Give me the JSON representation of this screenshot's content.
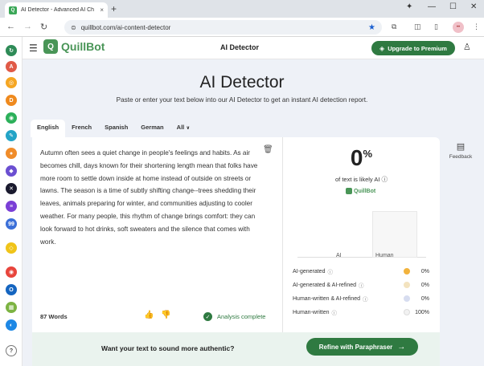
{
  "browser": {
    "tab_title": "AI Detector - Advanced AI Ch",
    "tab_close": "×",
    "new_tab": "+",
    "url": "quillbot.com/ai-content-detector",
    "profile_initials": "••",
    "minimize": "—",
    "maximize": "☐",
    "close": "✕"
  },
  "header": {
    "logo_text": "QuillBot",
    "logo_mark": "Q",
    "title": "AI Detector",
    "premium_label": "Upgrade to Premium"
  },
  "hero": {
    "title": "AI Detector",
    "subtitle": "Paste or enter your text below into our AI Detector to get an instant AI detection report."
  },
  "languages": {
    "tabs": [
      "English",
      "French",
      "Spanish",
      "German",
      "All"
    ],
    "active": "English"
  },
  "feedback_label": "Feedback",
  "editor": {
    "text": "Autumn often sees a quiet change in people's feelings and habits. As air becomes chill, days known for their shortening length mean that folks have more room to settle down inside at home instead of outside on streets or lawns. The season is a time of subtly shifting change--trees shedding their leaves, animals preparing for winter, and communities adjusting to cooler weather. For many people, this rhythm of change brings comfort: they can look forward to hot drinks, soft sweaters and the silence that comes with work.",
    "word_count": "87 Words",
    "status": "Analysis complete"
  },
  "result": {
    "percent": "0",
    "percent_sign": "%",
    "caption": "of text is likely AI",
    "brand": "QuillBot"
  },
  "chart_data": {
    "type": "bar",
    "categories": [
      "AI",
      "Human"
    ],
    "values": [
      0,
      100
    ]
  },
  "breakdown": [
    {
      "label": "AI-generated",
      "value": "0%",
      "color": "#f2b33d"
    },
    {
      "label": "AI-generated & AI-refined",
      "value": "0%",
      "color": "#f3e3bf"
    },
    {
      "label": "Human-written & AI-refined",
      "value": "0%",
      "color": "#d7ddf0"
    },
    {
      "label": "Human-written",
      "value": "100%",
      "color": "#f2f2f2"
    }
  ],
  "cta": {
    "question": "Want your text to sound more authentic?",
    "button_label": "Refine with Paraphraser"
  },
  "colors": {
    "brand_green": "#499557",
    "button_green": "#2f7a41"
  }
}
